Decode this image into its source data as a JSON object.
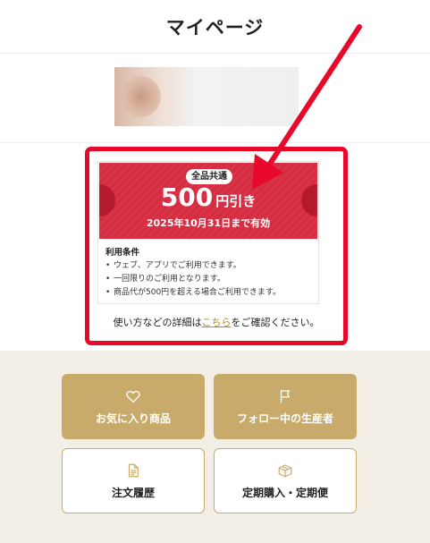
{
  "header": {
    "title": "マイページ"
  },
  "coupon": {
    "badge": "全品共通",
    "amount": "500",
    "amount_unit": "円引き",
    "validity": "2025年10月31日まで有効",
    "conditions_title": "利用条件",
    "conditions": [
      "ウェブ、アプリでご利用できます。",
      "一回限りのご利用となります。",
      "商品代が500円を超える場合ご利用できます。"
    ],
    "accent_color": "#d93347"
  },
  "note": {
    "before": "使い方などの詳細は",
    "link": "こちら",
    "after": "をご確認ください。"
  },
  "menu": {
    "favorites": {
      "label": "お気に入り商品",
      "icon": "heart-icon"
    },
    "following": {
      "label": "フォロー中の生産者",
      "icon": "flag-icon"
    },
    "orders": {
      "label": "注文履歴",
      "icon": "document-icon"
    },
    "subscription": {
      "label": "定期購入・定期便",
      "icon": "box-icon"
    }
  },
  "colors": {
    "highlight": "#e8082a",
    "gold": "#c8ab6a",
    "beige_bg": "#f3efe7"
  }
}
